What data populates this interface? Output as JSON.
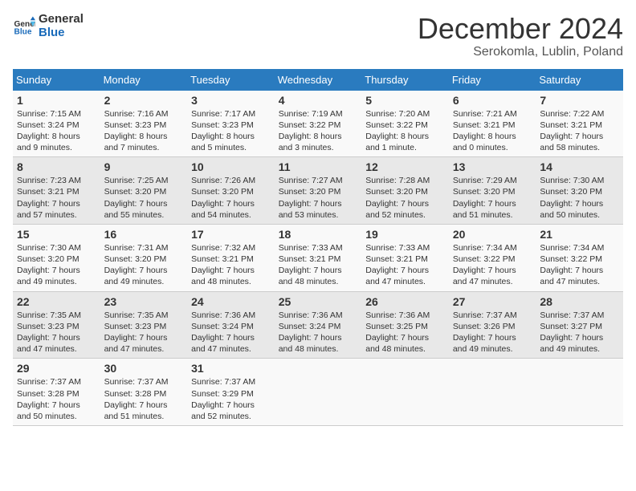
{
  "header": {
    "logo_line1": "General",
    "logo_line2": "Blue",
    "month": "December 2024",
    "location": "Serokomla, Lublin, Poland"
  },
  "weekdays": [
    "Sunday",
    "Monday",
    "Tuesday",
    "Wednesday",
    "Thursday",
    "Friday",
    "Saturday"
  ],
  "weeks": [
    [
      {
        "day": 1,
        "sunrise": "7:15 AM",
        "sunset": "3:24 PM",
        "daylight": "8 hours and 9 minutes."
      },
      {
        "day": 2,
        "sunrise": "7:16 AM",
        "sunset": "3:23 PM",
        "daylight": "8 hours and 7 minutes."
      },
      {
        "day": 3,
        "sunrise": "7:17 AM",
        "sunset": "3:23 PM",
        "daylight": "8 hours and 5 minutes."
      },
      {
        "day": 4,
        "sunrise": "7:19 AM",
        "sunset": "3:22 PM",
        "daylight": "8 hours and 3 minutes."
      },
      {
        "day": 5,
        "sunrise": "7:20 AM",
        "sunset": "3:22 PM",
        "daylight": "8 hours and 1 minute."
      },
      {
        "day": 6,
        "sunrise": "7:21 AM",
        "sunset": "3:21 PM",
        "daylight": "8 hours and 0 minutes."
      },
      {
        "day": 7,
        "sunrise": "7:22 AM",
        "sunset": "3:21 PM",
        "daylight": "7 hours and 58 minutes."
      }
    ],
    [
      {
        "day": 8,
        "sunrise": "7:23 AM",
        "sunset": "3:21 PM",
        "daylight": "7 hours and 57 minutes."
      },
      {
        "day": 9,
        "sunrise": "7:25 AM",
        "sunset": "3:20 PM",
        "daylight": "7 hours and 55 minutes."
      },
      {
        "day": 10,
        "sunrise": "7:26 AM",
        "sunset": "3:20 PM",
        "daylight": "7 hours and 54 minutes."
      },
      {
        "day": 11,
        "sunrise": "7:27 AM",
        "sunset": "3:20 PM",
        "daylight": "7 hours and 53 minutes."
      },
      {
        "day": 12,
        "sunrise": "7:28 AM",
        "sunset": "3:20 PM",
        "daylight": "7 hours and 52 minutes."
      },
      {
        "day": 13,
        "sunrise": "7:29 AM",
        "sunset": "3:20 PM",
        "daylight": "7 hours and 51 minutes."
      },
      {
        "day": 14,
        "sunrise": "7:30 AM",
        "sunset": "3:20 PM",
        "daylight": "7 hours and 50 minutes."
      }
    ],
    [
      {
        "day": 15,
        "sunrise": "7:30 AM",
        "sunset": "3:20 PM",
        "daylight": "7 hours and 49 minutes."
      },
      {
        "day": 16,
        "sunrise": "7:31 AM",
        "sunset": "3:20 PM",
        "daylight": "7 hours and 49 minutes."
      },
      {
        "day": 17,
        "sunrise": "7:32 AM",
        "sunset": "3:21 PM",
        "daylight": "7 hours and 48 minutes."
      },
      {
        "day": 18,
        "sunrise": "7:33 AM",
        "sunset": "3:21 PM",
        "daylight": "7 hours and 48 minutes."
      },
      {
        "day": 19,
        "sunrise": "7:33 AM",
        "sunset": "3:21 PM",
        "daylight": "7 hours and 47 minutes."
      },
      {
        "day": 20,
        "sunrise": "7:34 AM",
        "sunset": "3:22 PM",
        "daylight": "7 hours and 47 minutes."
      },
      {
        "day": 21,
        "sunrise": "7:34 AM",
        "sunset": "3:22 PM",
        "daylight": "7 hours and 47 minutes."
      }
    ],
    [
      {
        "day": 22,
        "sunrise": "7:35 AM",
        "sunset": "3:23 PM",
        "daylight": "7 hours and 47 minutes."
      },
      {
        "day": 23,
        "sunrise": "7:35 AM",
        "sunset": "3:23 PM",
        "daylight": "7 hours and 47 minutes."
      },
      {
        "day": 24,
        "sunrise": "7:36 AM",
        "sunset": "3:24 PM",
        "daylight": "7 hours and 47 minutes."
      },
      {
        "day": 25,
        "sunrise": "7:36 AM",
        "sunset": "3:24 PM",
        "daylight": "7 hours and 48 minutes."
      },
      {
        "day": 26,
        "sunrise": "7:36 AM",
        "sunset": "3:25 PM",
        "daylight": "7 hours and 48 minutes."
      },
      {
        "day": 27,
        "sunrise": "7:37 AM",
        "sunset": "3:26 PM",
        "daylight": "7 hours and 49 minutes."
      },
      {
        "day": 28,
        "sunrise": "7:37 AM",
        "sunset": "3:27 PM",
        "daylight": "7 hours and 49 minutes."
      }
    ],
    [
      {
        "day": 29,
        "sunrise": "7:37 AM",
        "sunset": "3:28 PM",
        "daylight": "7 hours and 50 minutes."
      },
      {
        "day": 30,
        "sunrise": "7:37 AM",
        "sunset": "3:28 PM",
        "daylight": "7 hours and 51 minutes."
      },
      {
        "day": 31,
        "sunrise": "7:37 AM",
        "sunset": "3:29 PM",
        "daylight": "7 hours and 52 minutes."
      },
      null,
      null,
      null,
      null
    ]
  ]
}
